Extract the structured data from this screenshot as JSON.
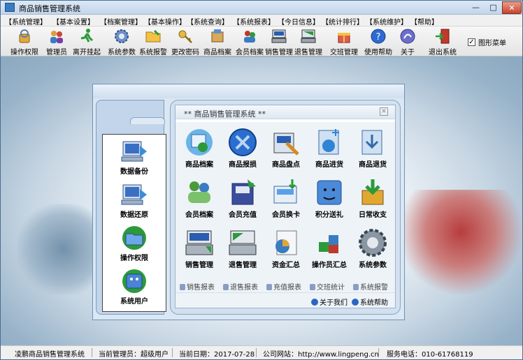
{
  "window": {
    "title": "商品销售管理系统",
    "controls": {
      "minimize": "—",
      "maximize": "□",
      "close": "✕"
    }
  },
  "menu": [
    "【系统管理】",
    "【基本设置】",
    "【档案管理】",
    "【基本操作】",
    "【系统查询】",
    "【系统报表】",
    "【今日信息】",
    "【统计排行】",
    "【系统维护】",
    "【帮助】"
  ],
  "toolbar": {
    "buttons": [
      "操作权限",
      "管理员",
      "离开挂起",
      "系统参数",
      "系统报警",
      "更改密码",
      "商品档案",
      "会员档案",
      "销售管理",
      "退售管理",
      "交班管理",
      "使用帮助",
      "关于",
      "退出系统"
    ],
    "checkbox_label": "图形菜单",
    "checkbox_checked": "✓"
  },
  "left_nav": [
    "数据备份",
    "数据还原",
    "操作权限",
    "系统用户"
  ],
  "panel": {
    "title": "**  商品销售管理系统  **",
    "close": "✕",
    "grid": [
      "商品档案",
      "商品报损",
      "商品盘点",
      "商品进货",
      "商品退货",
      "会员档案",
      "会员充值",
      "会员换卡",
      "积分送礼",
      "日常收支",
      "销售管理",
      "退售管理",
      "资金汇总",
      "操作员汇总",
      "系统参数"
    ],
    "links": [
      "销售报表",
      "退售报表",
      "充值报表",
      "交班统计",
      "系统报警"
    ],
    "bottom": [
      "关于我们",
      "系统帮助"
    ]
  },
  "status": {
    "company": "凌鹏商品销售管理系统",
    "admin": "当前管理员：超级用户",
    "date": "当前日期：2017-07-28",
    "site": "公司网站：http://www.lingpeng.cn",
    "phone": "服务电话：010-61768119"
  },
  "colors": {
    "accent": "#3a7cc2",
    "panel_bg": "#dbe7f3",
    "close_red": "#c8432a"
  }
}
